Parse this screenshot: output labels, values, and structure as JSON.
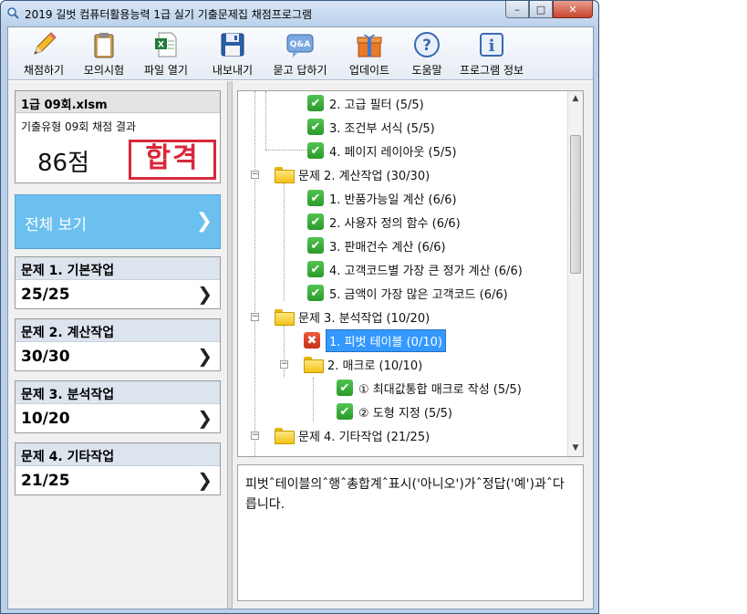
{
  "window": {
    "title": "2019 길벗 컴퓨터활용능력 1급 실기 기출문제집 채점프로그램",
    "minimize": "–",
    "maximize": "□",
    "close": "✕"
  },
  "toolbar": {
    "items": [
      {
        "label": "채점하기",
        "icon": "pencil-icon"
      },
      {
        "label": "모의시험",
        "icon": "clipboard-icon"
      },
      {
        "label": "파일 열기",
        "icon": "excel-file-icon"
      },
      {
        "label": "내보내기",
        "icon": "floppy-disk-icon"
      },
      {
        "label": "묻고 답하기",
        "icon": "qa-bubble-icon"
      },
      {
        "label": "업데이트",
        "icon": "gift-box-icon"
      },
      {
        "label": "도움말",
        "icon": "help-icon"
      },
      {
        "label": "프로그램 정보",
        "icon": "info-icon"
      }
    ]
  },
  "summary": {
    "file_name": "1급 09회.xlsm",
    "result_title": "기출유형 09회 채점 결과",
    "score": "86점",
    "stamp": "합격"
  },
  "overall": {
    "label": "전체 보기",
    "chevron": "❯"
  },
  "problems": [
    {
      "title": "문제 1. 기본작업",
      "score": "25/25",
      "chevron": "❯"
    },
    {
      "title": "문제 2. 계산작업",
      "score": "30/30",
      "chevron": "❯"
    },
    {
      "title": "문제 3. 분석작업",
      "score": "10/20",
      "chevron": "❯"
    },
    {
      "title": "문제 4. 기타작업",
      "score": "21/25",
      "chevron": "❯"
    }
  ],
  "tree": {
    "rows": [
      {
        "label": "2. 고급 필터 (5/5)",
        "mark": "✔"
      },
      {
        "label": "3. 조건부 서식 (5/5)",
        "mark": "✔"
      },
      {
        "label": "4. 페이지 레이아웃 (5/5)",
        "mark": "✔"
      },
      {
        "label": "문제 2. 계산작업 (30/30)",
        "expander": "−"
      },
      {
        "label": "1. 반품가능일 계산 (6/6)",
        "mark": "✔"
      },
      {
        "label": "2. 사용자 정의 함수 (6/6)",
        "mark": "✔"
      },
      {
        "label": "3. 판매건수 계산 (6/6)",
        "mark": "✔"
      },
      {
        "label": "4. 고객코드별 가장 큰 정가 계산 (6/6)",
        "mark": "✔"
      },
      {
        "label": "5. 금액이 가장 많은 고객코드 (6/6)",
        "mark": "✔"
      },
      {
        "label": "문제 3. 분석작업 (10/20)",
        "expander": "−"
      },
      {
        "label": "1. 피벗 테이블 (0/10)",
        "mark": "✖"
      },
      {
        "label": "2. 매크로 (10/10)",
        "expander": "−"
      },
      {
        "label": "① 최대값통합 매크로 작성 (5/5)",
        "mark": "✔"
      },
      {
        "label": "② 도형 지정 (5/5)",
        "mark": "✔"
      },
      {
        "label": "문제 4. 기타작업 (21/25)",
        "expander": "−"
      }
    ],
    "scroll_up": "▲",
    "scroll_down": "▼"
  },
  "detail": {
    "text": "피벗ˆ테이블의ˆ행ˆ총합계ˆ표시('아니오')가ˆ정답('예')과ˆ다릅니다."
  }
}
